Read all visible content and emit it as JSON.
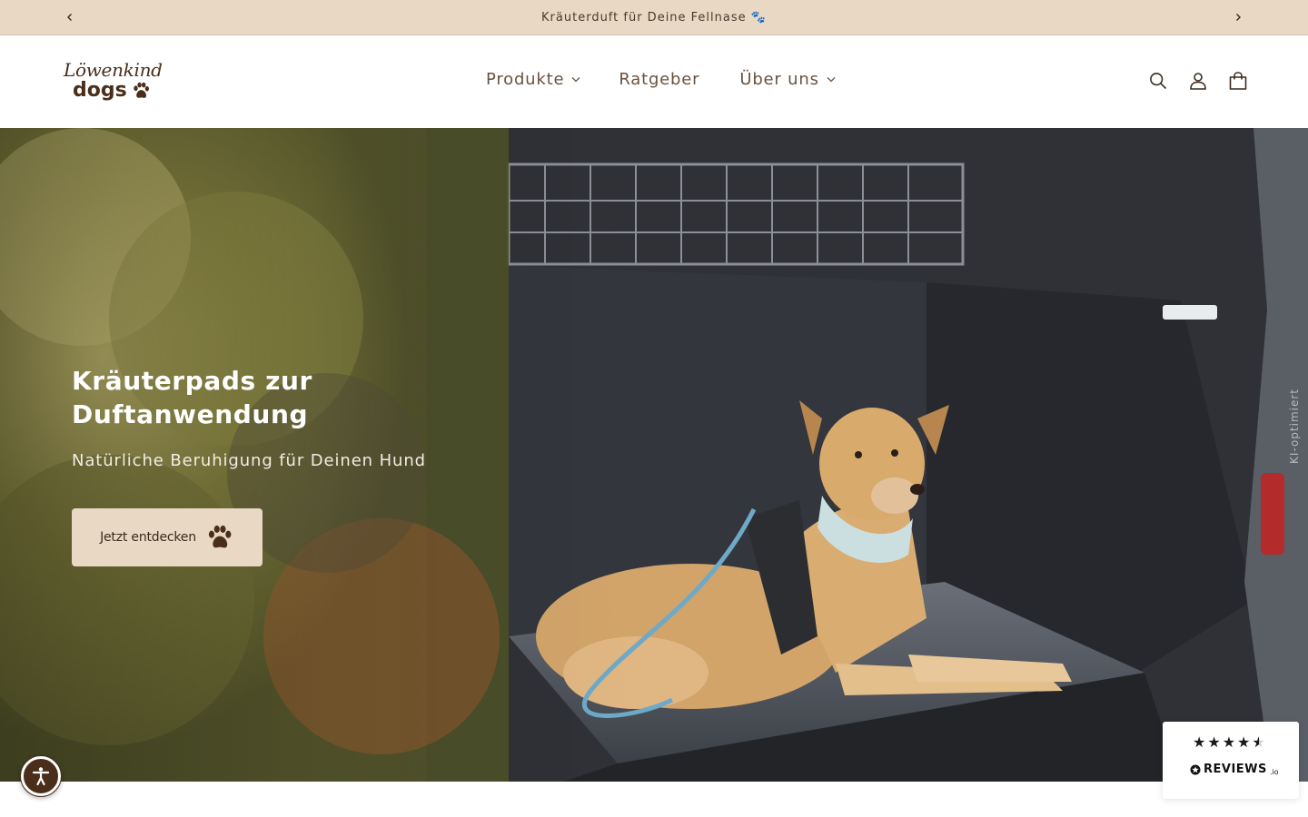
{
  "announcement": {
    "text": "Kräuterduft für Deine Fellnase 🐾",
    "prev_icon": "chevron-left-icon",
    "next_icon": "chevron-right-icon"
  },
  "header": {
    "logo": {
      "line1": "Löwenkind",
      "line2": "dogs",
      "icon": "paw-icon"
    },
    "nav": [
      {
        "label": "Produkte",
        "has_dropdown": true
      },
      {
        "label": "Ratgeber",
        "has_dropdown": false
      },
      {
        "label": "Über uns",
        "has_dropdown": true
      }
    ],
    "icons": [
      "search-icon",
      "account-icon",
      "cart-icon"
    ]
  },
  "hero": {
    "title": "Kräuterpads zur Duftanwendung",
    "subtitle": "Natürliche Beruhigung für Deinen Hund",
    "button_label": "Jetzt entdecken",
    "button_icon": "paw-icon",
    "side_label": "KI-optimiert"
  },
  "widgets": {
    "accessibility_icon": "accessibility-icon",
    "reviews": {
      "rating_stars": 4.5,
      "brand": "REVIEWS",
      "brand_suffix": ".io"
    }
  },
  "colors": {
    "announcement_bg": "#e8d8c4",
    "brand_brown": "#4a2e1a",
    "button_bg": "#e8d8c4"
  }
}
